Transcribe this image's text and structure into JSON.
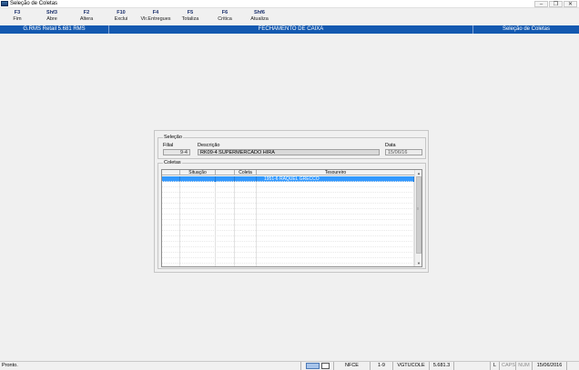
{
  "window": {
    "title": "Seleção de Coletas"
  },
  "toolbar": [
    {
      "key": "F3",
      "label": "Fim"
    },
    {
      "key": "Shf3",
      "label": "Abre"
    },
    {
      "key": "F2",
      "label": "Altera"
    },
    {
      "key": "F10",
      "label": "Exclui"
    },
    {
      "key": "F4",
      "label": "Vlr.Entregues"
    },
    {
      "key": "F5",
      "label": "Totaliza"
    },
    {
      "key": "F6",
      "label": "Critica"
    },
    {
      "key": "Shf6",
      "label": "Atualiza"
    }
  ],
  "header": {
    "app": "G.RMS Retail 5.681 RMS",
    "screen": "FECHAMENTO DE CAIXA",
    "context": "Seleção de Coletas"
  },
  "selecao": {
    "group_title": "Seleção",
    "filial_label": "Filial",
    "filial_value": "9-4",
    "descricao_label": "Descrição",
    "descricao_value": "RK09-4 SUPERMERCADO HIRA",
    "data_label": "Data",
    "data_value": "15/06/16"
  },
  "coletas": {
    "group_title": "Coletas",
    "columns": [
      "",
      "Situação",
      "",
      "Coleta",
      "Tesoureiro"
    ],
    "rows": [
      [
        "",
        "",
        "",
        "",
        "1951-6 RAQUEL GRECCO"
      ]
    ],
    "empty_rows": 16
  },
  "status": {
    "message": "Pronto.",
    "nfce": "NFCE",
    "filial": "1-9",
    "user": "VGTUCOLE",
    "version": "5.681.3",
    "l": "L",
    "caps": "CAPS",
    "num": "NUM",
    "date": "15/06/2016"
  }
}
